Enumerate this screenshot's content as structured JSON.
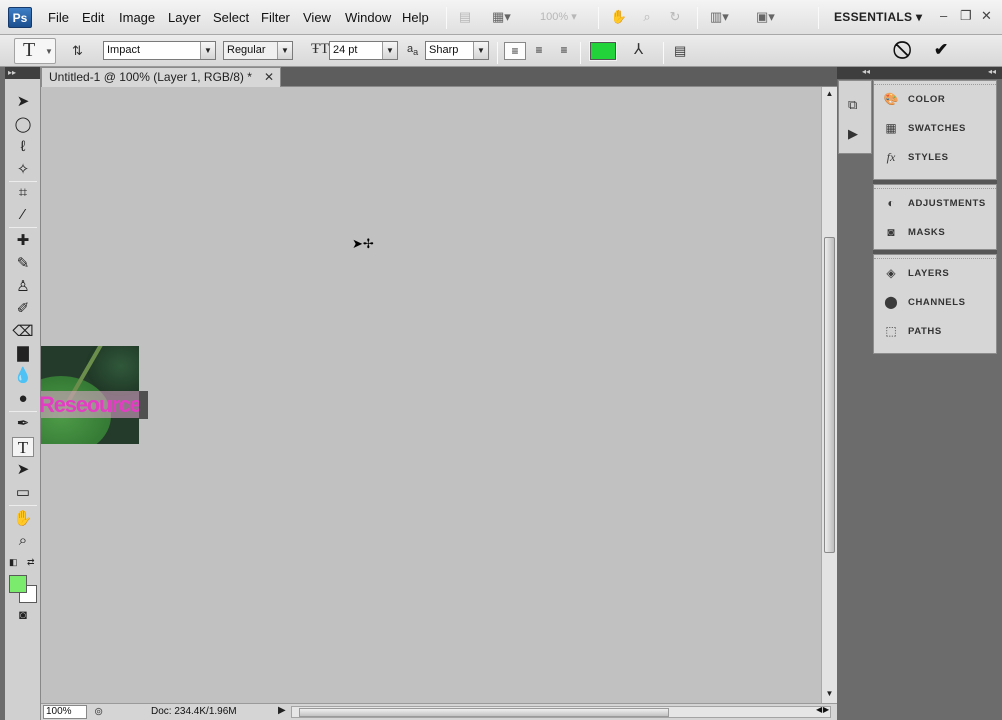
{
  "app": {
    "logo": "Ps"
  },
  "menu": [
    "File",
    "Edit",
    "Image",
    "Layer",
    "Select",
    "Filter",
    "View",
    "Window",
    "Help"
  ],
  "appbar": {
    "zoom": "100%",
    "workspace": "ESSENTIALS"
  },
  "options": {
    "font_family": "Impact",
    "font_style": "Regular",
    "font_size": "24 pt",
    "aa_label": "a",
    "aa_sublabel": "a",
    "antialias": "Sharp",
    "text_color": "#22d33a"
  },
  "document": {
    "tab_title": "Untitled-1 @ 100% (Layer 1, RGB/8) *",
    "canvas_text": "Reseource",
    "canvas_bg": "#c1c1c1"
  },
  "status": {
    "zoom": "100%",
    "doc_info": "Doc: 234.4K/1.96M"
  },
  "tools": {
    "foreground": "#7aeb6c",
    "background": "#ffffff"
  },
  "panels": {
    "group1": [
      {
        "label": "COLOR",
        "icon": "color-icon"
      },
      {
        "label": "SWATCHES",
        "icon": "swatches-icon"
      },
      {
        "label": "STYLES",
        "icon": "fx-icon"
      }
    ],
    "group2": [
      {
        "label": "ADJUSTMENTS",
        "icon": "adjustments-icon"
      },
      {
        "label": "MASKS",
        "icon": "masks-icon"
      }
    ],
    "group3": [
      {
        "label": "LAYERS",
        "icon": "layers-icon"
      },
      {
        "label": "CHANNELS",
        "icon": "channels-icon"
      },
      {
        "label": "PATHS",
        "icon": "paths-icon"
      }
    ]
  }
}
